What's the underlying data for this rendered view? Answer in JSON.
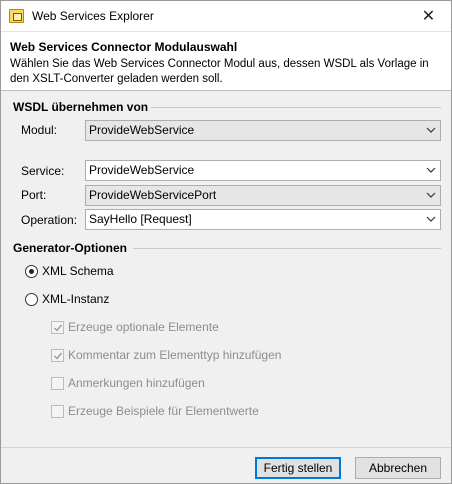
{
  "window": {
    "title": "Web Services Explorer",
    "close_glyph": "✕"
  },
  "header": {
    "title": "Web Services Connector Modulauswahl",
    "description": "Wählen Sie das Web Services Connector Modul aus, dessen WSDL als Vorlage in den XSLT-Converter geladen werden soll."
  },
  "wsdl": {
    "section_title": "WSDL übernehmen von",
    "modul_label": "Modul:",
    "modul_value": "ProvideWebService",
    "service_label": "Service:",
    "service_value": "ProvideWebService",
    "port_label": "Port:",
    "port_value": "ProvideWebServicePort",
    "operation_label": "Operation:",
    "operation_value": "SayHello [Request]"
  },
  "generator": {
    "section_title": "Generator-Optionen",
    "radio_xml_schema": "XML Schema",
    "radio_xml_instanz": "XML-Instanz",
    "selected": "XML Schema",
    "options": [
      {
        "label": "Erzeuge optionale Elemente",
        "checked": true
      },
      {
        "label": "Kommentar zum Elementtyp hinzufügen",
        "checked": true
      },
      {
        "label": "Anmerkungen hinzufügen",
        "checked": false
      },
      {
        "label": "Erzeuge Beispiele für Elementwerte",
        "checked": false
      }
    ]
  },
  "buttons": {
    "ok_label": "Fertig stellen",
    "cancel_label": "Abbrechen"
  },
  "icons": {
    "app": "web-services-app-icon",
    "close": "close-icon",
    "dropdown": "chevron-down-icon",
    "check": "checkmark-icon"
  }
}
